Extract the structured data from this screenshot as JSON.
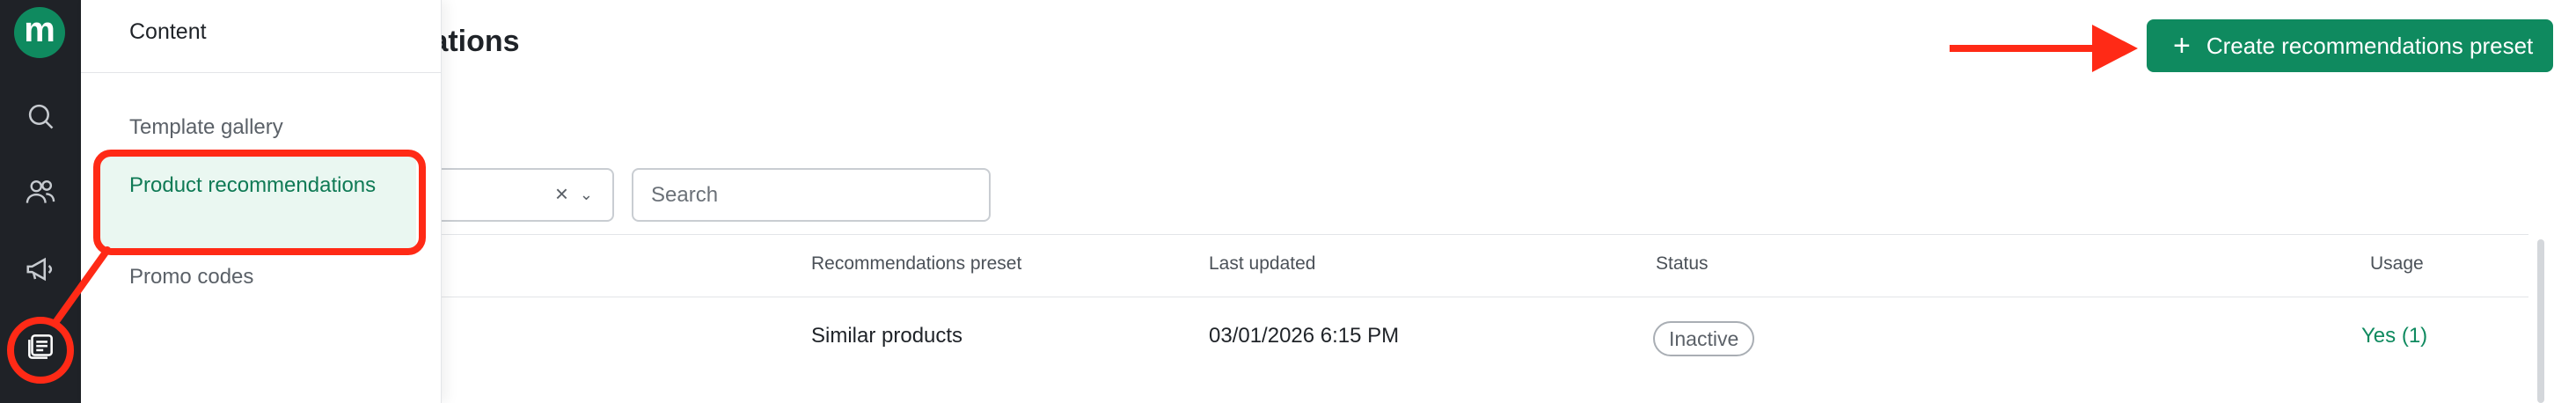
{
  "app": {
    "logo_letter": "m",
    "brand_color": "#0f8a5f",
    "annotation_color": "#ff2a16"
  },
  "rail": {
    "items": [
      {
        "icon": "search-icon"
      },
      {
        "icon": "people-icon"
      },
      {
        "icon": "megaphone-icon"
      },
      {
        "icon": "content-icon",
        "active": true
      }
    ]
  },
  "flyout": {
    "title": "Content",
    "items": [
      {
        "label": "Template gallery"
      },
      {
        "label": "Product recommendations",
        "active": true
      },
      {
        "label": "Promo codes"
      }
    ]
  },
  "page": {
    "title": "endations",
    "create_button_label": "Create recommendations preset"
  },
  "filters": {
    "clear_glyph": "×",
    "search_placeholder": "Search"
  },
  "table": {
    "columns": [
      "Recommendations preset",
      "Last updated",
      "Status",
      "Usage"
    ],
    "rows": [
      {
        "preset": "Similar products",
        "last_updated": "03/01/2026 6:15 PM",
        "status": "Inactive",
        "usage": "Yes (1)"
      }
    ]
  }
}
